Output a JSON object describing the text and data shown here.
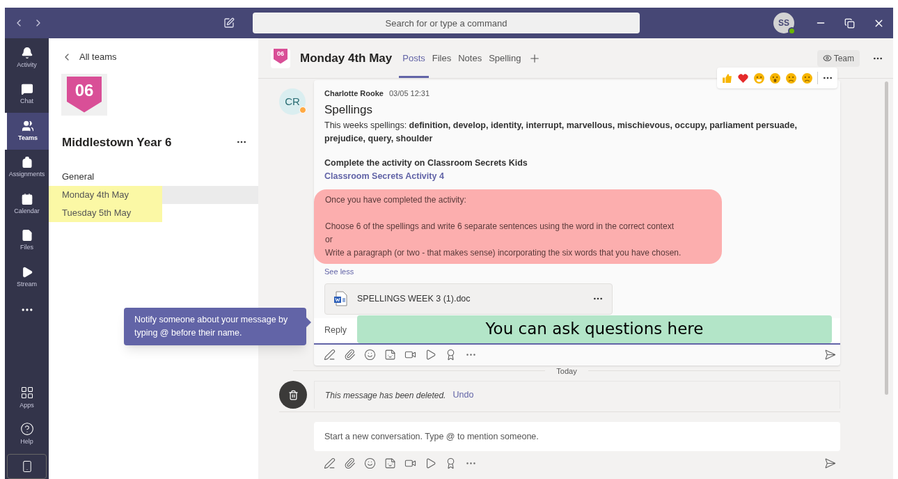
{
  "top_bar": {
    "search": {
      "placeholder": "Search for or type a command"
    },
    "avatar": "SS",
    "avatar_online": true
  },
  "rail": [
    {
      "label": "Activity",
      "selected": false
    },
    {
      "label": "Chat",
      "selected": false
    },
    {
      "label": "Teams",
      "selected": true
    },
    {
      "label": "Assignments",
      "selected": false
    },
    {
      "label": "Calendar",
      "selected": false
    },
    {
      "label": "Files",
      "selected": false
    },
    {
      "label": "Stream",
      "selected": false
    }
  ],
  "rail_bottom": [
    {
      "label": "Apps"
    },
    {
      "label": "Help"
    }
  ],
  "team_panel": {
    "back": "All teams",
    "logo": "06",
    "name": "Middlestown Year 6",
    "channels": [
      {
        "name": "General",
        "selected": false,
        "highlighted": false
      },
      {
        "name": "Monday 4th May",
        "selected": true,
        "highlighted": true
      },
      {
        "name": "Tuesday 5th May",
        "selected": false,
        "highlighted": true
      }
    ]
  },
  "channel_header": {
    "logo": "06",
    "title": "Monday 4th May",
    "tabs": [
      {
        "label": "Posts",
        "selected": true
      },
      {
        "label": "Files",
        "selected": false
      },
      {
        "label": "Notes",
        "selected": false
      },
      {
        "label": "Spelling",
        "selected": false
      }
    ],
    "team_button": "Team"
  },
  "post": {
    "author_initials": "CR",
    "author_away": true,
    "author": "Charlotte Rooke",
    "time": "03/05 12:31",
    "title": "Spellings",
    "intro": "This weeks spellings: **definition, develop, identity, interrupt, marvellous, mischievous, occupy, parliament persuade, prejudice, query, shoulder**",
    "instruction": "Complete the activity on Classroom Secrets Kids",
    "link": "Classroom Secrets Activity 4",
    "highlight_lines": [
      "Once you have completed the activity:",
      "Choose 6 of the spellings and write 6 separate sentences using the word in the correct context",
      "or",
      "Write a paragraph (or two - that makes sense) incorporating the six words that you have chosen."
    ],
    "see_less": "See less",
    "attachment": "SPELLINGS WEEK 3 (1).doc",
    "reply": "Reply",
    "reply_note": "You can ask questions here"
  },
  "tooltip": "Notify someone about your message by typing @ before their name.",
  "divider": "Today",
  "deleted": {
    "text": "This message has been deleted.",
    "undo": "Undo"
  },
  "compose": {
    "placeholder": "Start a new conversation. Type @ to mention someone."
  }
}
